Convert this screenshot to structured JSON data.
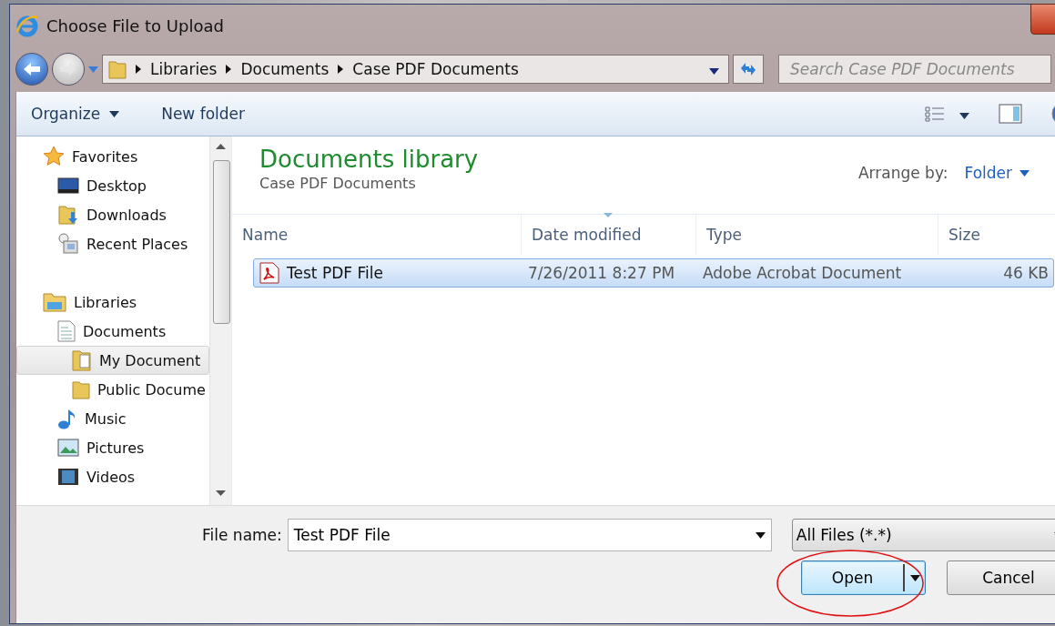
{
  "window": {
    "title": "Choose File to Upload"
  },
  "address": {
    "crumbs": [
      "Libraries",
      "Documents",
      "Case PDF Documents"
    ]
  },
  "search": {
    "placeholder": "Search Case PDF Documents"
  },
  "toolbar": {
    "buttons": [
      "Organize",
      "New folder"
    ]
  },
  "nav": [
    {
      "label": "Favorites",
      "selected": false,
      "children": [
        {
          "label": "Desktop",
          "selected": false
        },
        {
          "label": "Downloads",
          "selected": false
        },
        {
          "label": "Recent Places",
          "selected": false
        }
      ]
    },
    {
      "label": "Libraries",
      "selected": false,
      "children": [
        {
          "label": "Documents",
          "selected": false,
          "children": [
            {
              "label": "My Document",
              "selected": true
            },
            {
              "label": "Public Docume",
              "selected": false
            }
          ]
        },
        {
          "label": "Music",
          "selected": false
        },
        {
          "label": "Pictures",
          "selected": false
        },
        {
          "label": "Videos",
          "selected": false
        }
      ]
    }
  ],
  "library": {
    "title": "Documents library",
    "subtitle": "Case PDF Documents",
    "arrange_label": "Arrange by:",
    "arrange_value": "Folder"
  },
  "table": {
    "columns": [
      "Name",
      "Date modified",
      "Type",
      "Size"
    ],
    "rows": [
      {
        "cells": [
          "Test PDF File",
          "7/26/2011 8:27 PM",
          "Adobe Acrobat Document",
          "46 KB"
        ],
        "selected": true
      }
    ]
  },
  "footer": {
    "file_name_label": "File name:",
    "file_name": "Test PDF File",
    "filter": "All Files (*.*)",
    "open": "Open",
    "cancel": "Cancel"
  }
}
